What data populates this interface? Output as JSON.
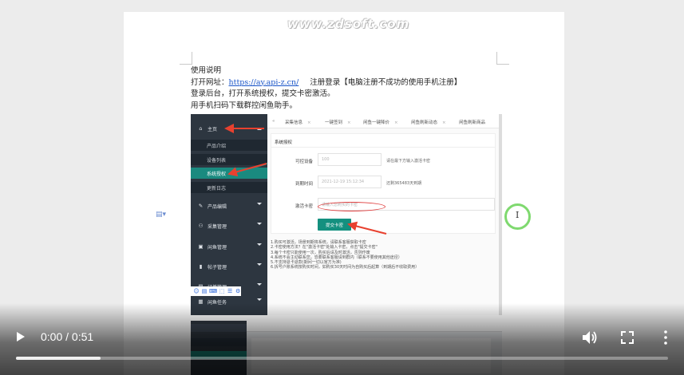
{
  "watermark": "www.zdsoft.com",
  "document": {
    "line1": "使用说明",
    "line2_prefix": "打开网址：",
    "line2_link": "https://ay.api-z.cn/",
    "line2_suffix": "注册登录【电脑注册不成功的使用手机注册】",
    "line3": "登录后台，打开系统授权，提交卡密激活。",
    "line4": "用手机扫码下载群控闲鱼助手。",
    "para_mark": "📄"
  },
  "screenshot": {
    "sidebar": {
      "home": "主页",
      "sub_items": [
        "产品介绍",
        "设备列表",
        "系统授权",
        "更新日志"
      ],
      "active_sub": "系统授权",
      "groups": [
        "产品编辑",
        "采集管理",
        "闲鱼管理",
        "帖子管理",
        "订单管理",
        "闲鱼任务"
      ]
    },
    "tabs": [
      "采集信息",
      "一键签到",
      "闲鱼一键降价",
      "闲鱼刷新动态",
      "闲鱼刷新商品"
    ],
    "panel_title": "系统授权",
    "form": {
      "device_label": "可控设备",
      "device_value": "100",
      "device_hint": "请在最下方输入激活卡密",
      "expire_label": "到期时间",
      "expire_value": "2021-12-19 15:12:34",
      "expire_hint": "还剩365483天到期",
      "card_label": "激活卡密",
      "card_placeholder": "请输入您购买的卡密",
      "submit_label": "提交卡密"
    },
    "notes": [
      "1.购买可激活，场景到期将系统，请联系客服获取卡密",
      "2.卡密使用方法？在\"激活卡密\"处输入卡密，点击\"提交卡密\"",
      "3.每个卡密只能使用一次，购买后请及时激活，否则作废",
      "4.系统不会主动联系您，恐要联系客服请到群内（联系不要使用其他途径）",
      "5.不支持退卡退款(期间一切以官方为准)",
      "6.拆号户账系统按购买时间，如购买30天时间为自购买后起算（到期后不收取费用）"
    ]
  },
  "ime_toolbar": [
    "S",
    "中",
    "♪",
    "☺",
    "▤",
    "⌨",
    "⬚",
    "☰",
    "⚙"
  ],
  "video": {
    "time": "0:00 / 0:51",
    "progress": 0,
    "buffered": 0.13
  },
  "colors": {
    "sidebar_bg": "#2d3640",
    "accent_teal": "#14907f",
    "link_blue": "#1a55c8",
    "arrow_red": "#e8412f",
    "ring_green": "#7fd96f"
  }
}
